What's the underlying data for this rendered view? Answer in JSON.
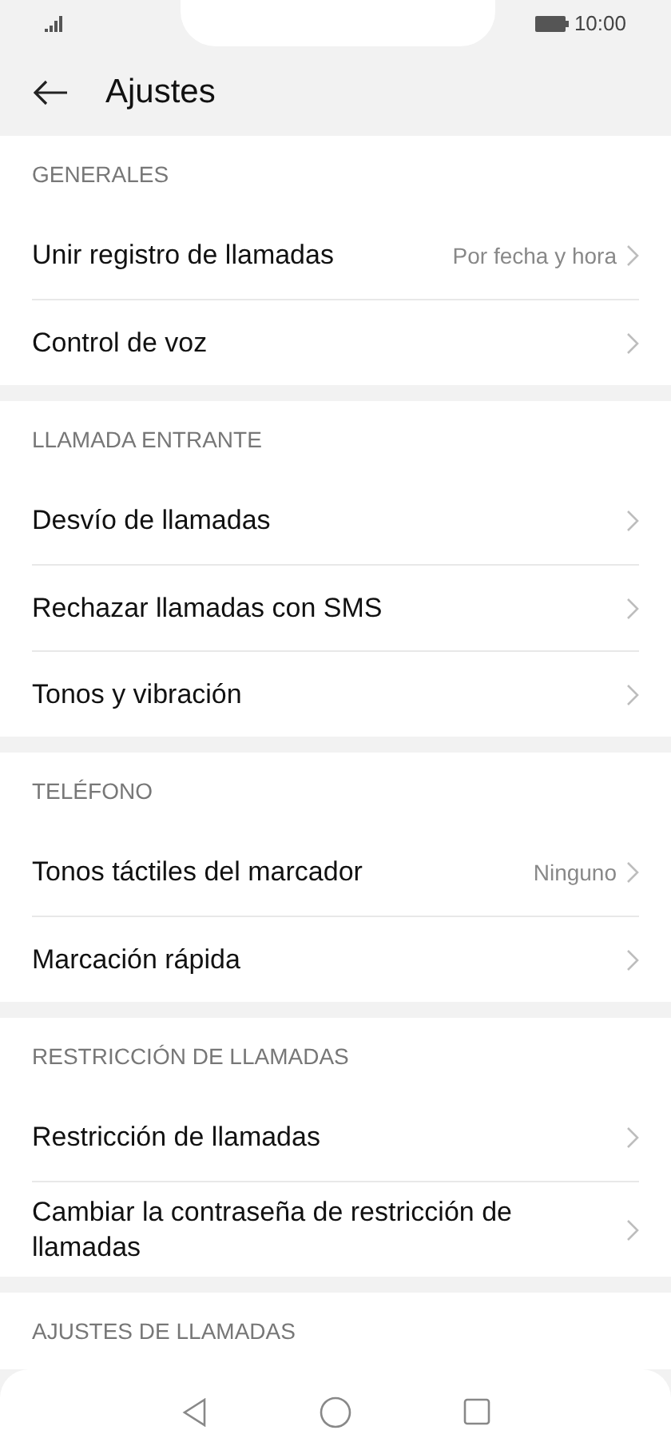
{
  "status_bar": {
    "time": "10:00"
  },
  "header": {
    "title": "Ajustes"
  },
  "sections": [
    {
      "title": "GENERALES",
      "items": [
        {
          "label": "Unir registro de llamadas",
          "value": "Por fecha y hora"
        },
        {
          "label": "Control de voz"
        }
      ]
    },
    {
      "title": "LLAMADA ENTRANTE",
      "items": [
        {
          "label": "Desvío de llamadas"
        },
        {
          "label": "Rechazar llamadas con SMS"
        },
        {
          "label": "Tonos y vibración"
        }
      ]
    },
    {
      "title": "TELÉFONO",
      "items": [
        {
          "label": "Tonos táctiles del marcador",
          "value": "Ninguno"
        },
        {
          "label": "Marcación rápida"
        }
      ]
    },
    {
      "title": "RESTRICCIÓN DE LLAMADAS",
      "items": [
        {
          "label": "Restricción de llamadas"
        },
        {
          "label": "Cambiar la contraseña de restricción de llamadas"
        }
      ]
    },
    {
      "title": "AJUSTES DE LLAMADAS"
    }
  ]
}
